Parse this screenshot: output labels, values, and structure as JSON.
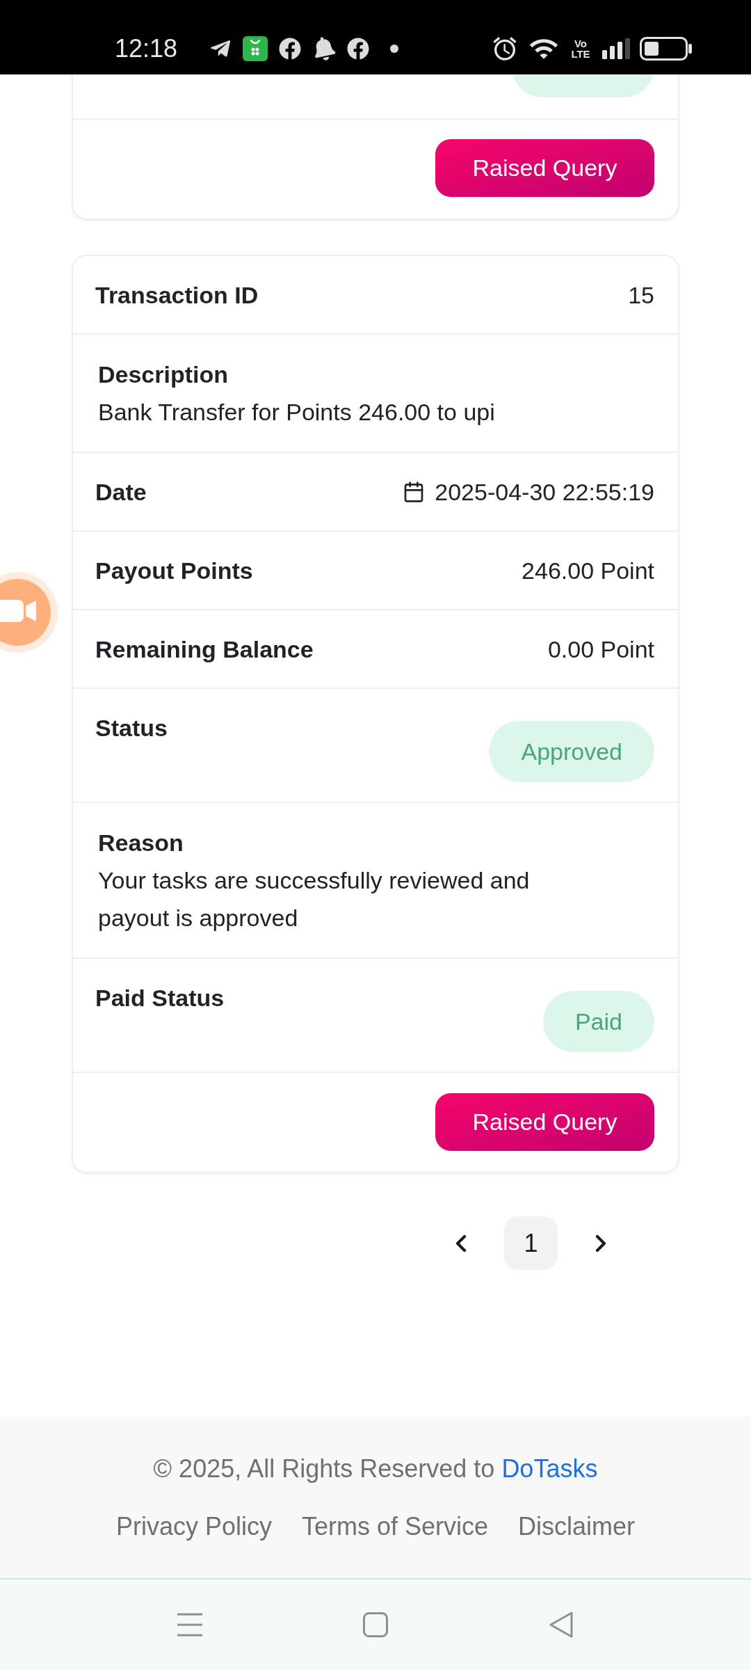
{
  "status_bar": {
    "time": "12:18",
    "network_label": "Vo LTE"
  },
  "previous_card": {
    "action_button": "Raised Query"
  },
  "transaction": {
    "fields": [
      {
        "kind": "inline",
        "label": "Transaction ID",
        "value": "15"
      },
      {
        "kind": "stacked",
        "label": "Description",
        "value": "Bank Transfer for Points 246.00 to upi"
      },
      {
        "kind": "date",
        "label": "Date",
        "value": "2025-04-30 22:55:19"
      },
      {
        "kind": "inline",
        "label": "Payout Points",
        "value": "246.00 Point"
      },
      {
        "kind": "inline",
        "label": "Remaining Balance",
        "value": "0.00 Point"
      },
      {
        "kind": "badge",
        "label": "Status",
        "value": "Approved"
      },
      {
        "kind": "stacked",
        "label": "Reason",
        "value": "Your tasks are successfully reviewed and payout is approved"
      },
      {
        "kind": "badge",
        "label": "Paid Status",
        "value": "Paid"
      }
    ],
    "action_button": "Raised Query"
  },
  "pagination": {
    "pages": [
      {
        "label": "1",
        "selected": true
      }
    ]
  },
  "footer": {
    "copyright": "© 2025, All Rights Reserved to",
    "brand_link": "DoTasks",
    "links": [
      "Privacy Policy",
      "Terms of Service",
      "Disclaimer"
    ]
  }
}
